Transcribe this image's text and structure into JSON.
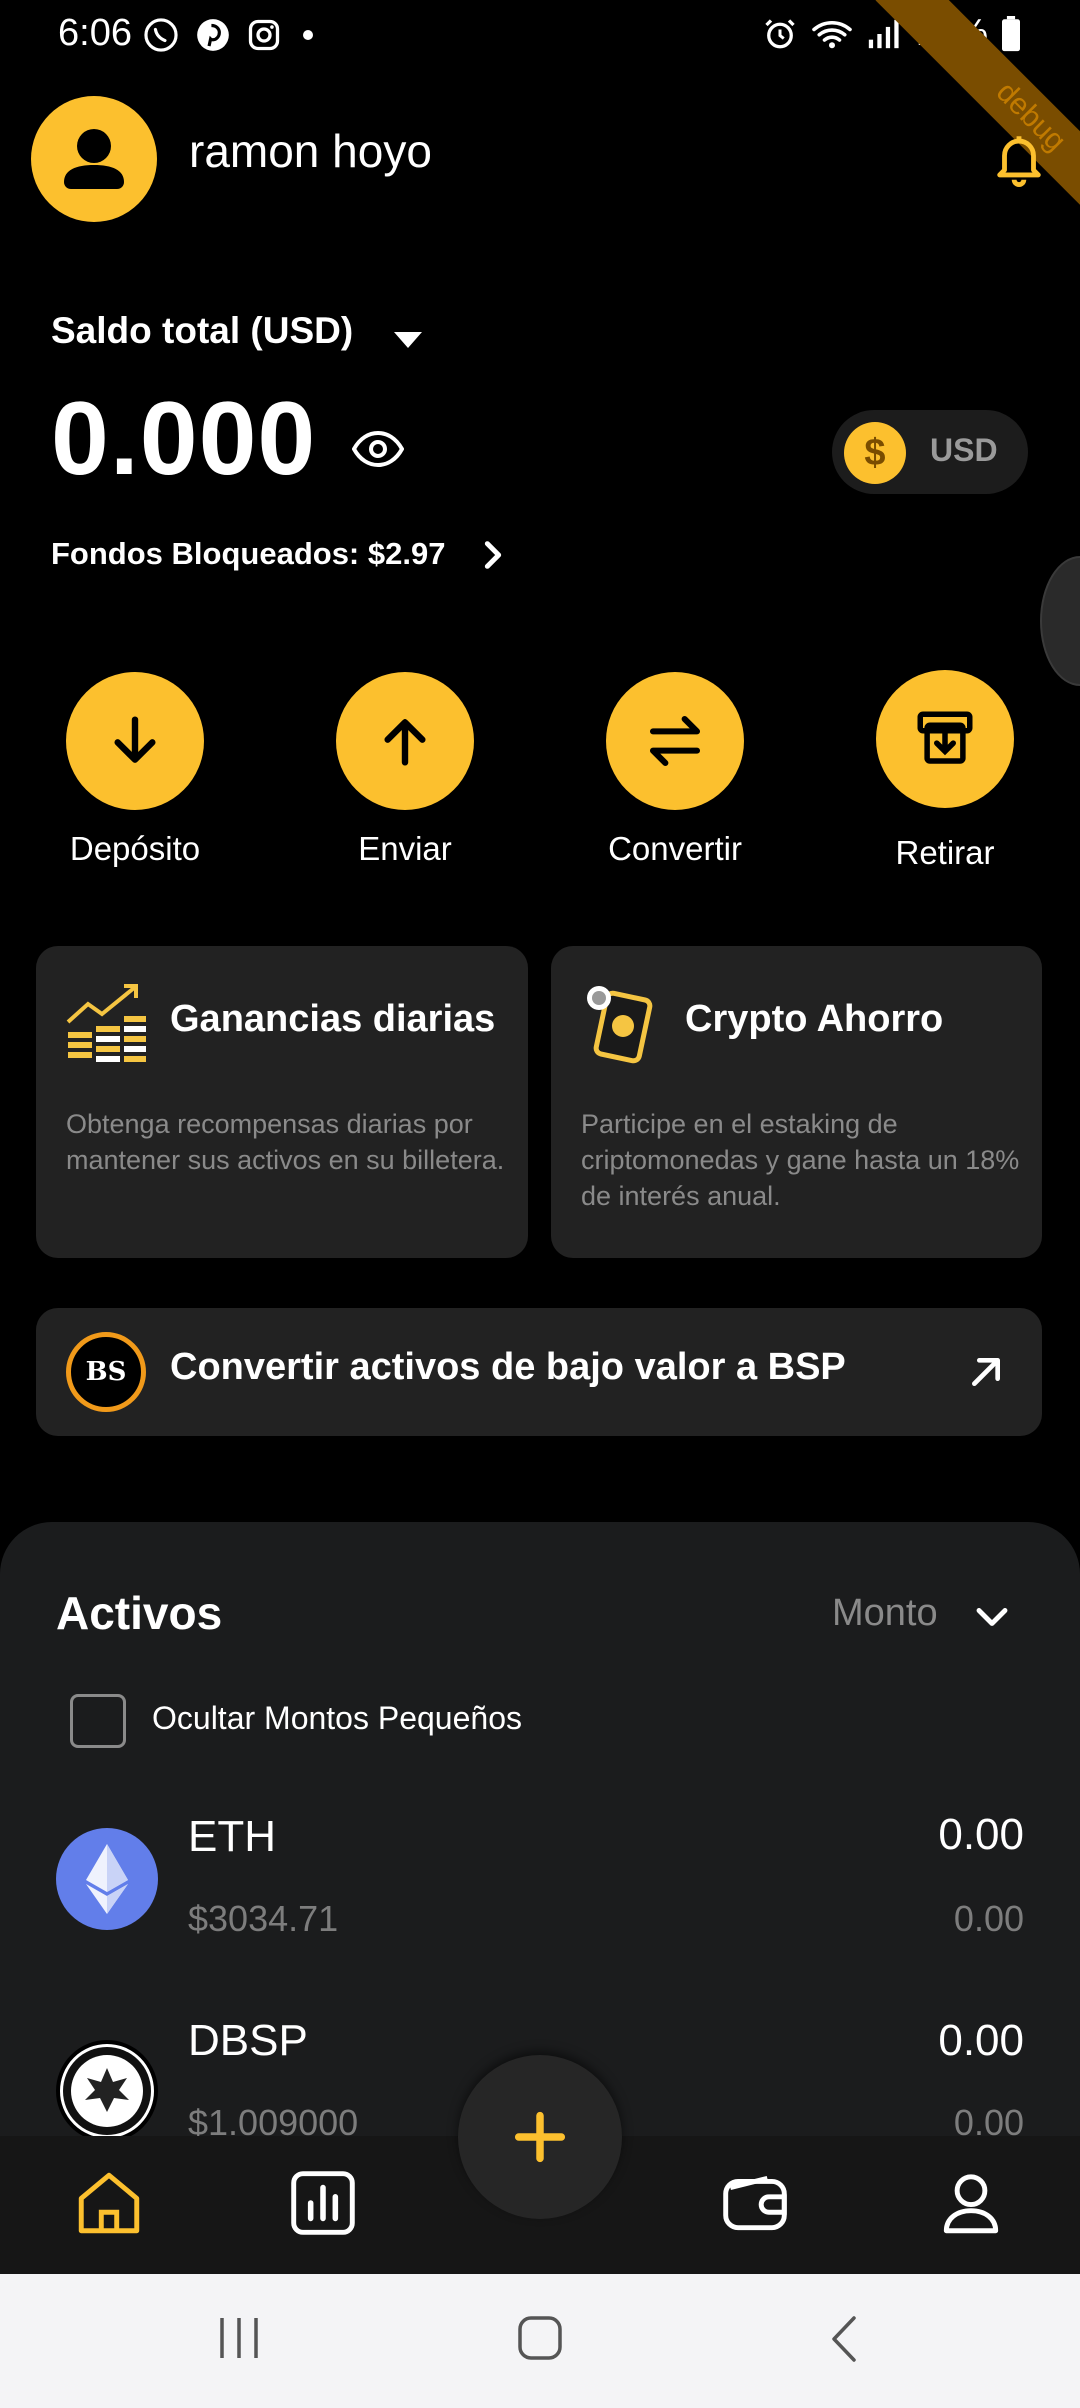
{
  "status_bar": {
    "time": "6:06",
    "battery": "79%"
  },
  "header": {
    "username": "ramon hoyo",
    "debug_ribbon": "debug",
    "icons": [
      "user-avatar",
      "bell-icon"
    ]
  },
  "balance": {
    "label": "Saldo total (USD)",
    "amount": "0.000",
    "currency": "USD",
    "coin_symbol": "$",
    "blocked_funds": "Fondos Bloqueados: $2.97"
  },
  "actions": [
    {
      "label": "Depósito",
      "icon": "arrow-down-icon"
    },
    {
      "label": "Enviar",
      "icon": "arrow-up-icon"
    },
    {
      "label": "Convertir",
      "icon": "swap-icon"
    },
    {
      "label": "Retirar",
      "icon": "withdraw-box-icon"
    }
  ],
  "cards": [
    {
      "title": "Ganancias diarias",
      "description": "Obtenga recompensas diarias por mantener sus activos en su billetera.",
      "icon": "chart-growth-icon"
    },
    {
      "title": "Crypto Ahorro",
      "description": "Participe en el estaking de criptomonedas y gane hasta un 18% de interés anual.",
      "icon": "crypto-savings-icon"
    }
  ],
  "convert_banner": {
    "text": "Convertir activos de bajo valor a BSP",
    "logo_text": "BS"
  },
  "assets": {
    "title": "Activos",
    "sort_label": "Monto",
    "hide_small": "Ocultar Montos Pequeños",
    "items": [
      {
        "name": "ETH",
        "price": "$3034.71",
        "amount": "0.00",
        "value": "0.00"
      },
      {
        "name": "DBSP",
        "price": "$1.009000",
        "amount": "0.00",
        "value": "0.00"
      }
    ]
  },
  "colors": {
    "accent": "#FCC02E",
    "background": "#000000",
    "card": "#222222",
    "panel": "#1B1C1D",
    "eth_blue": "#627EEA"
  }
}
